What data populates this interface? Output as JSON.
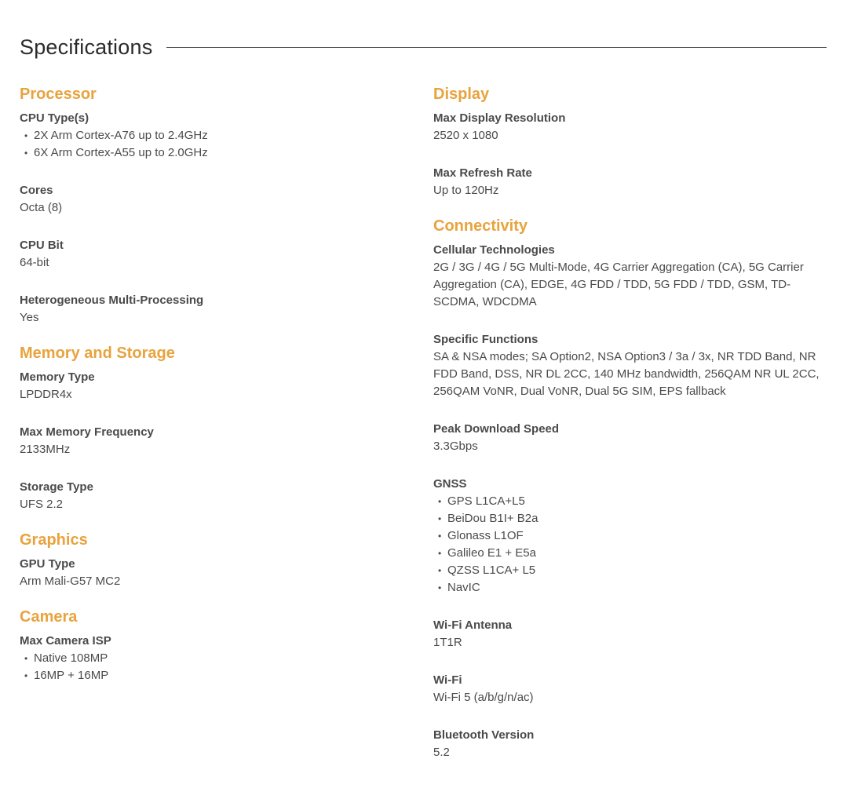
{
  "page": {
    "title": "Specifications",
    "accent_color": "#E8A33D",
    "text_color": "#4A4A4A"
  },
  "left_sections": [
    {
      "heading": "Processor",
      "specs": [
        {
          "label": "CPU Type(s)",
          "items": [
            "2X Arm Cortex-A76 up to 2.4GHz",
            "6X Arm Cortex-A55 up to 2.0GHz"
          ]
        },
        {
          "label": "Cores",
          "value": "Octa (8)"
        },
        {
          "label": "CPU Bit",
          "value": "64-bit"
        },
        {
          "label": "Heterogeneous Multi-Processing",
          "value": "Yes"
        }
      ]
    },
    {
      "heading": "Memory and Storage",
      "specs": [
        {
          "label": "Memory Type",
          "value": "LPDDR4x"
        },
        {
          "label": "Max Memory Frequency",
          "value": "2133MHz"
        },
        {
          "label": "Storage Type",
          "value": "UFS 2.2"
        }
      ]
    },
    {
      "heading": "Graphics",
      "specs": [
        {
          "label": "GPU Type",
          "value": "Arm Mali-G57 MC2"
        }
      ]
    },
    {
      "heading": "Camera",
      "specs": [
        {
          "label": "Max Camera ISP",
          "items": [
            "Native 108MP",
            "16MP + 16MP"
          ]
        }
      ]
    }
  ],
  "right_sections": [
    {
      "heading": "Display",
      "specs": [
        {
          "label": "Max Display Resolution",
          "value": "2520 x 1080"
        },
        {
          "label": "Max Refresh Rate",
          "value": "Up to 120Hz"
        }
      ]
    },
    {
      "heading": "Connectivity",
      "specs": [
        {
          "label": "Cellular Technologies",
          "value": "2G / 3G / 4G / 5G Multi-Mode, 4G Carrier Aggregation (CA), 5G Carrier Aggregation (CA), EDGE, 4G FDD / TDD, 5G FDD / TDD, GSM, TD-SCDMA, WDCDMA"
        },
        {
          "label": "Specific Functions",
          "value": "SA & NSA modes; SA Option2, NSA Option3 / 3a / 3x, NR TDD Band, NR FDD Band, DSS, NR DL 2CC, 140 MHz bandwidth, 256QAM NR UL 2CC, 256QAM VoNR, Dual VoNR, Dual 5G SIM, EPS fallback"
        },
        {
          "label": "Peak Download Speed",
          "value": "3.3Gbps"
        },
        {
          "label": "GNSS",
          "items": [
            "GPS L1CA+L5",
            "BeiDou B1I+ B2a",
            "Glonass L1OF",
            "Galileo E1 + E5a",
            "QZSS L1CA+ L5",
            "NavIC"
          ]
        },
        {
          "label": "Wi-Fi Antenna",
          "value": "1T1R"
        },
        {
          "label": "Wi-Fi",
          "value": "Wi-Fi 5 (a/b/g/n/ac)"
        },
        {
          "label": "Bluetooth Version",
          "value": "5.2"
        }
      ]
    }
  ]
}
